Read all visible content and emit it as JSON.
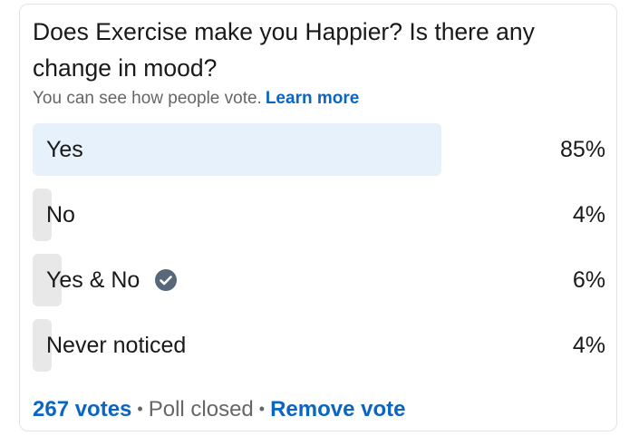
{
  "poll": {
    "question": "Does Exercise make you Happier? Is there any change in mood?",
    "visibility_note": "You can see how people vote.",
    "learn_more_label": "Learn more",
    "options": [
      {
        "label": "Yes",
        "percent_label": "85%",
        "percent": 85,
        "selected_by_user": true
      },
      {
        "label": "No",
        "percent_label": "4%",
        "percent": 4,
        "selected_by_user": false
      },
      {
        "label": "Yes & No",
        "percent_label": "6%",
        "percent": 6,
        "selected_by_user": false,
        "icon": "check-circle-icon"
      },
      {
        "label": "Never noticed",
        "percent_label": "4%",
        "percent": 4,
        "selected_by_user": false
      }
    ],
    "footer": {
      "votes_label": "267 votes",
      "status_label": "Poll closed",
      "remove_vote_label": "Remove vote"
    }
  },
  "colors": {
    "accent": "#0a66c2",
    "selected_bar": "#e6f1fc",
    "bar": "#e8e8e8",
    "text": "#191919",
    "muted_text": "#666666",
    "check_icon": "#56687a"
  }
}
